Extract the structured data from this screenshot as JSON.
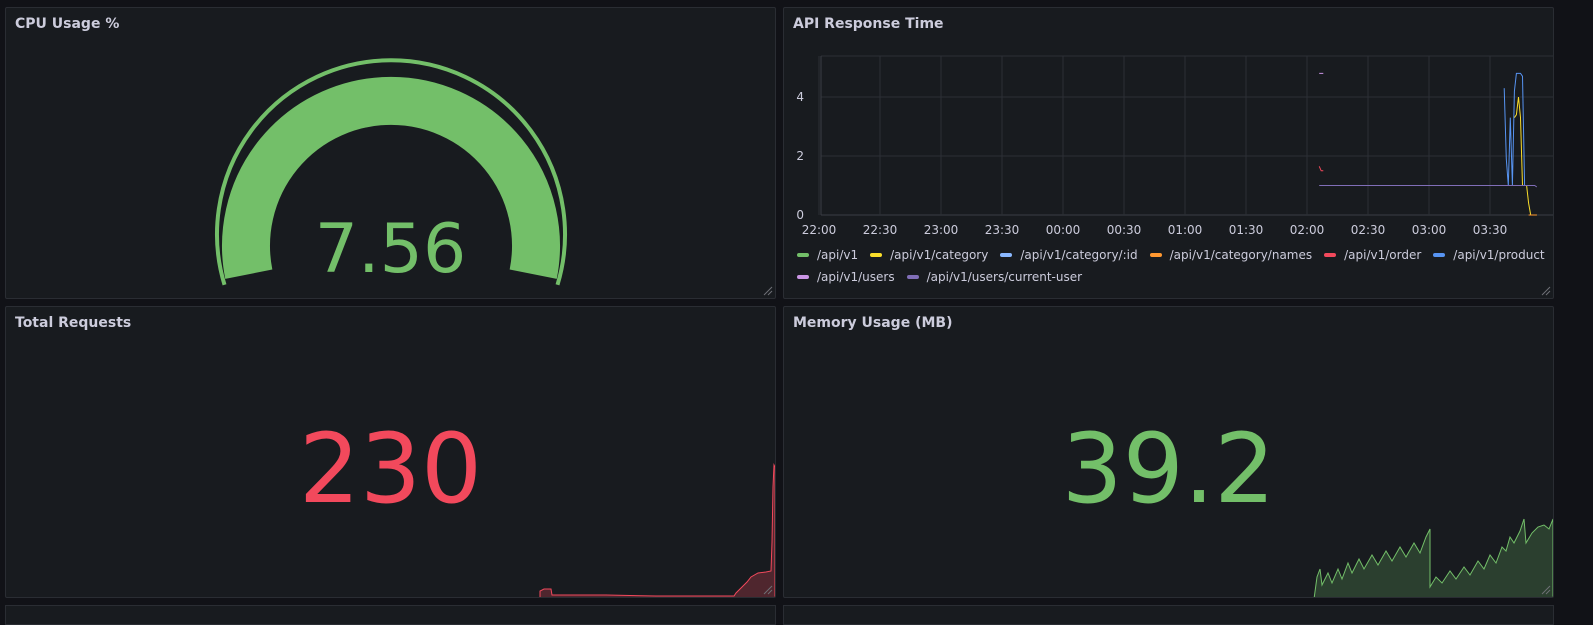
{
  "panels": {
    "cpu": {
      "title": "CPU Usage %",
      "value": "7.56",
      "color": "#73bf69"
    },
    "api": {
      "title": "API Response Time",
      "chart_data": {
        "type": "line",
        "x_ticks": [
          "22:00",
          "22:30",
          "23:00",
          "23:30",
          "00:00",
          "00:30",
          "01:00",
          "01:30",
          "02:00",
          "02:30",
          "03:00",
          "03:30"
        ],
        "y_ticks": [
          "0",
          "2",
          "4"
        ],
        "ylim": [
          0,
          5.4
        ],
        "grid": true,
        "legend_placement": "bottom",
        "series": [
          {
            "name": "/api/v1",
            "color": "#73bf69",
            "points": []
          },
          {
            "name": "/api/v1/category",
            "color": "#fade2a",
            "points": [
              [
                "03:42",
                3.3
              ],
              [
                "03:43",
                3.4
              ],
              [
                "03:44",
                4.0
              ],
              [
                "03:45",
                3.3
              ],
              [
                "03:46",
                1.0
              ],
              [
                "03:48",
                1.0
              ],
              [
                "03:49",
                0.4
              ],
              [
                "03:50",
                0.0
              ],
              [
                "03:53",
                0.0
              ]
            ]
          },
          {
            "name": "/api/v1/category/:id",
            "color": "#8ab8ff",
            "points": [
              [
                "03:38",
                1.0
              ],
              [
                "03:39",
                1.0
              ],
              [
                "03:40",
                1.0
              ],
              [
                "03:41",
                1.0
              ]
            ]
          },
          {
            "name": "/api/v1/category/names",
            "color": "#ff9830",
            "points": [
              [
                "03:49",
                0.0
              ],
              [
                "03:53",
                0.0
              ]
            ]
          },
          {
            "name": "/api/v1/order",
            "color": "#f2495c",
            "points": [
              [
                "02:06",
                1.65
              ],
              [
                "02:07",
                1.5
              ],
              [
                "02:08",
                1.5
              ]
            ]
          },
          {
            "name": "/api/v1/product",
            "color": "#5794f2",
            "points": [
              [
                "03:37",
                4.3
              ],
              [
                "03:38",
                1.9
              ],
              [
                "03:39",
                1.0
              ],
              [
                "03:40",
                3.3
              ],
              [
                "03:41",
                1.0
              ],
              [
                "03:42",
                4.2
              ],
              [
                "03:43",
                4.8
              ],
              [
                "03:45",
                4.8
              ],
              [
                "03:46",
                4.7
              ],
              [
                "03:47",
                1.0
              ],
              [
                "03:48",
                1.0
              ]
            ]
          },
          {
            "name": "/api/v1/users",
            "color": "#ca95e5",
            "points": [
              [
                "02:06",
                4.8
              ],
              [
                "02:08",
                4.8
              ]
            ]
          },
          {
            "name": "/api/v1/users/current-user",
            "color": "#806eb7",
            "points": [
              [
                "02:06",
                1.0
              ],
              [
                "02:08",
                1.0
              ],
              [
                "03:52",
                1.0
              ],
              [
                "03:53",
                0.95
              ]
            ]
          }
        ]
      }
    },
    "requests": {
      "title": "Total Requests",
      "value": "230",
      "color": "#f2495c"
    },
    "memory": {
      "title": "Memory Usage (MB)",
      "value": "39.2",
      "color": "#73bf69"
    }
  }
}
